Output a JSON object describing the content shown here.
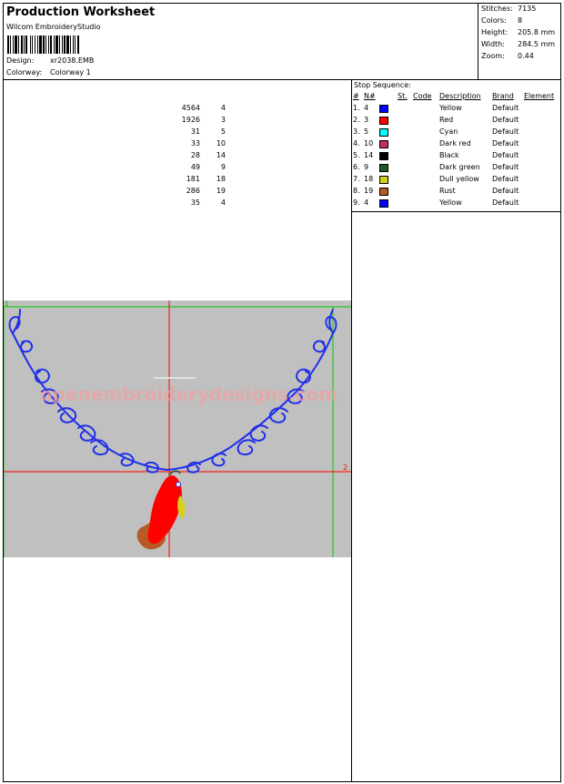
{
  "header": {
    "title": "Production Worksheet",
    "software": "Wilcom EmbroideryStudio",
    "design_label": "Design:",
    "design_value": "xr2038.EMB",
    "colorway_label": "Colorway:",
    "colorway_value": "Colorway 1"
  },
  "stats": [
    {
      "label": "Stitches:",
      "value": "7135"
    },
    {
      "label": "Colors:",
      "value": "8"
    },
    {
      "label": "Height:",
      "value": "205.8 mm"
    },
    {
      "label": "Width:",
      "value": "284.5 mm"
    },
    {
      "label": "Zoom:",
      "value": "0.44"
    }
  ],
  "stop_sequence": {
    "title": "Stop Sequence:",
    "headers": {
      "idx": "#",
      "n": "N#",
      "st": "St.",
      "code": "Code",
      "desc": "Description",
      "brand": "Brand",
      "element": "Element"
    },
    "rows": [
      {
        "idx": "1.",
        "n": "4",
        "color": "#0000ff",
        "st": "4564",
        "code": "4",
        "desc": "Yellow",
        "brand": "Default"
      },
      {
        "idx": "2.",
        "n": "3",
        "color": "#ff0000",
        "st": "1926",
        "code": "3",
        "desc": "Red",
        "brand": "Default"
      },
      {
        "idx": "3.",
        "n": "5",
        "color": "#00ffff",
        "st": "31",
        "code": "5",
        "desc": "Cyan",
        "brand": "Default"
      },
      {
        "idx": "4.",
        "n": "10",
        "color": "#c0305a",
        "st": "33",
        "code": "10",
        "desc": "Dark red",
        "brand": "Default"
      },
      {
        "idx": "5.",
        "n": "14",
        "color": "#000000",
        "st": "28",
        "code": "14",
        "desc": "Black",
        "brand": "Default"
      },
      {
        "idx": "6.",
        "n": "9",
        "color": "#1a5a2a",
        "st": "49",
        "code": "9",
        "desc": "Dark green",
        "brand": "Default"
      },
      {
        "idx": "7.",
        "n": "18",
        "color": "#d4d020",
        "st": "181",
        "code": "18",
        "desc": "Dull yellow",
        "brand": "Default"
      },
      {
        "idx": "8.",
        "n": "19",
        "color": "#b85a28",
        "st": "286",
        "code": "19",
        "desc": "Rust",
        "brand": "Default"
      },
      {
        "idx": "9.",
        "n": "4",
        "color": "#0000ff",
        "st": "35",
        "code": "4",
        "desc": "Yellow",
        "brand": "Default"
      }
    ]
  },
  "preview": {
    "watermark": "openembroiderydesigns.com",
    "guide_marker": "2",
    "corner_marker": "1",
    "colors": {
      "background": "#c0c0c0",
      "thread_blue": "#2030e8",
      "guide_red": "#ff0000",
      "guide_green": "#00cc00",
      "bird_red": "#ff0000",
      "bird_yellow": "#d4d020",
      "bird_rust": "#b85a28"
    }
  }
}
